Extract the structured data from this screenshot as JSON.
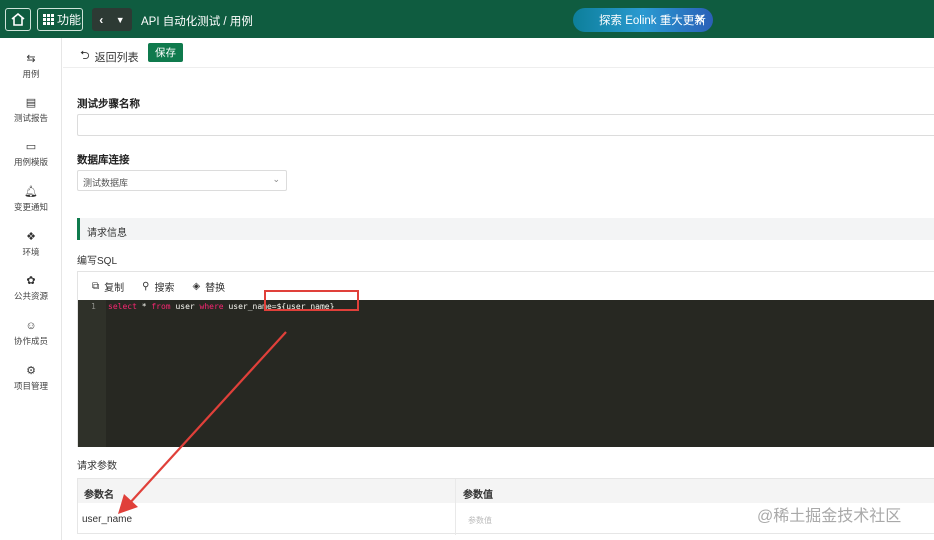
{
  "topbar": {
    "functions_label": "功能",
    "breadcrumb": "API 自动化测试 / 用例",
    "promo_text": "探索 Eolink 重大更新"
  },
  "sidebar": {
    "items": [
      {
        "label": "用例",
        "icon": "swap-arrows-icon"
      },
      {
        "label": "测试报告",
        "icon": "report-icon"
      },
      {
        "label": "用例模版",
        "icon": "template-icon"
      },
      {
        "label": "变更通知",
        "icon": "bell-icon"
      },
      {
        "label": "环境",
        "icon": "environment-icon"
      },
      {
        "label": "公共资源",
        "icon": "shared-resource-icon"
      },
      {
        "label": "协作成员",
        "icon": "member-icon"
      },
      {
        "label": "项目管理",
        "icon": "settings-icon"
      }
    ]
  },
  "actions": {
    "back_label": "返回列表",
    "save_label": "保存"
  },
  "form": {
    "step_name_label": "测试步骤名称",
    "step_name_value": "",
    "db_label": "数据库连接",
    "db_value": "测试数据库"
  },
  "request": {
    "section_title": "请求信息",
    "sql_label": "编写SQL",
    "toolbar": {
      "copy": "复制",
      "search": "搜索",
      "replace": "替换"
    },
    "line_number": "1",
    "sql_parts": [
      "select",
      " * ",
      "from",
      " user ",
      "where",
      " user_name=${user_name}"
    ]
  },
  "params": {
    "title": "请求参数",
    "col_name": "参数名",
    "col_value": "参数值",
    "rows": [
      {
        "name": "user_name",
        "value_placeholder": "参数值"
      }
    ]
  },
  "watermark": "@稀土掘金技术社区",
  "colors": {
    "brand": "#0f5c40",
    "accent": "#0f7a4d",
    "highlight": "#e0403a",
    "editor_bg": "#272822"
  }
}
